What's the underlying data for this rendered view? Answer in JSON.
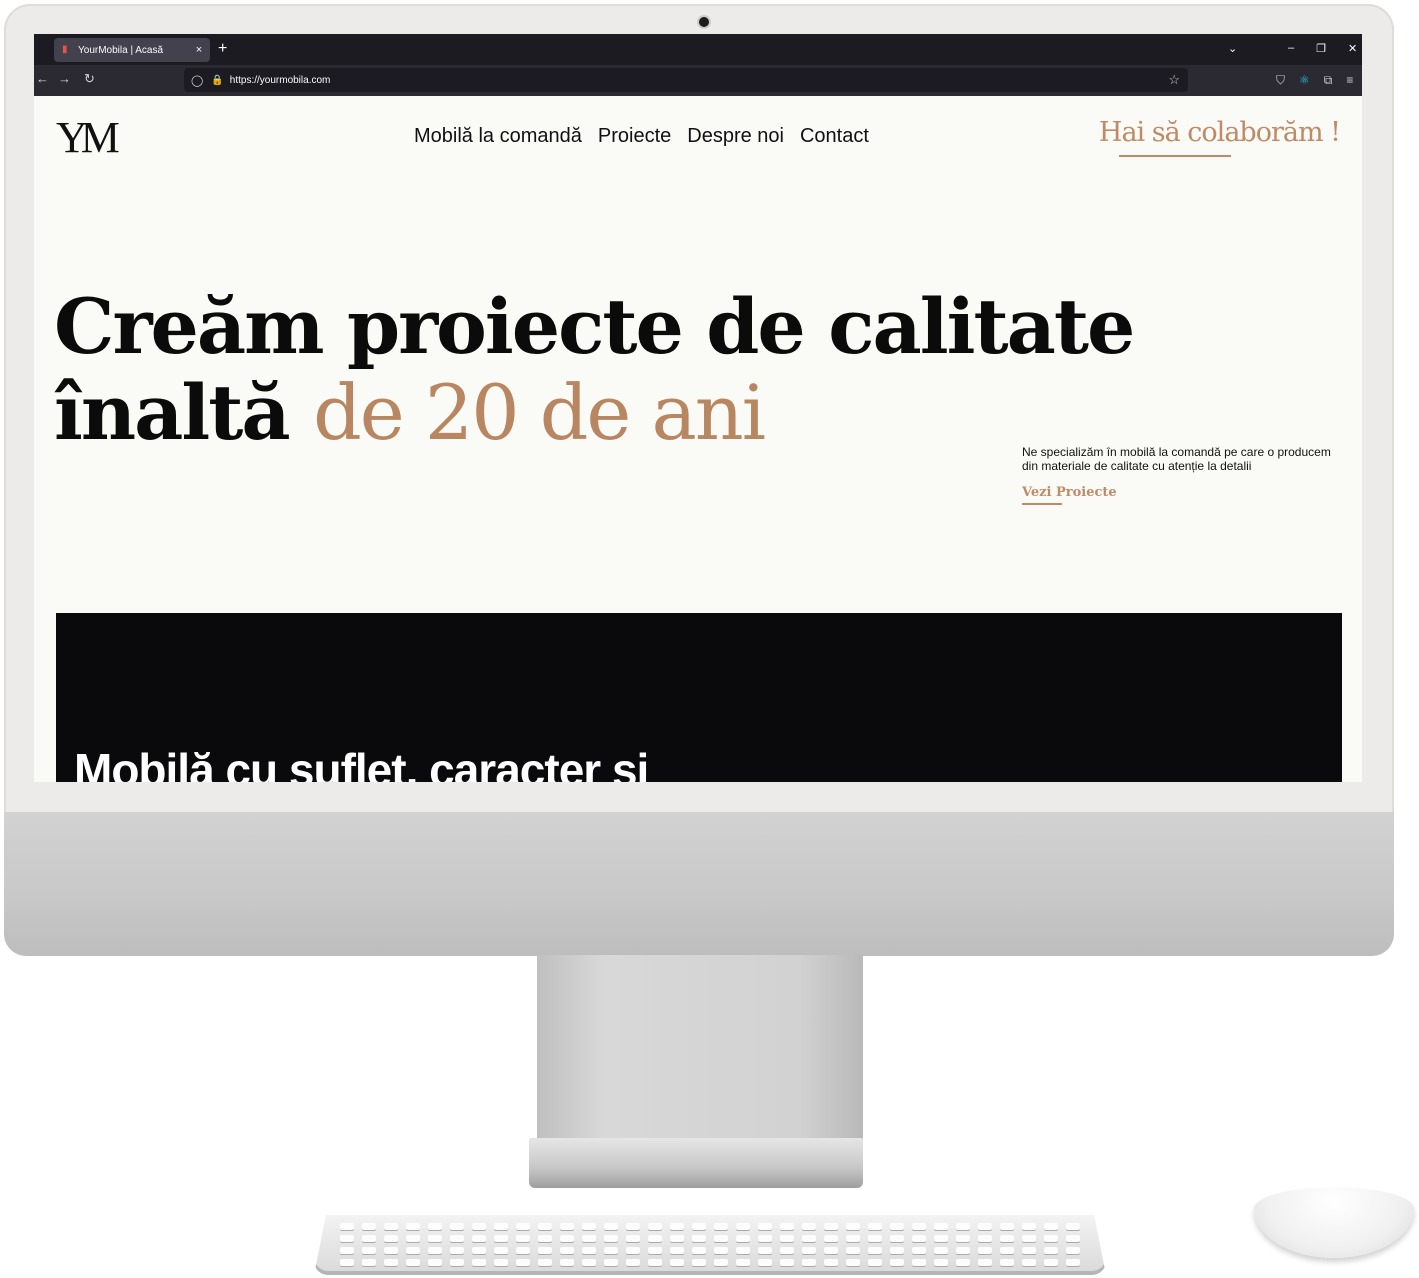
{
  "browser": {
    "tab_title": "YourMobila | Acasă",
    "tab_close": "×",
    "new_tab": "+",
    "tab_list": "⌄",
    "window_controls": [
      "–",
      "❐",
      "✕"
    ],
    "url": "https://yourmobila.com",
    "nav_icons": {
      "back": "←",
      "forward": "→",
      "reload": "↻"
    },
    "toolbar_icons": [
      "pocket-icon",
      "react-devtools-icon",
      "extensions-icon",
      "menu-icon"
    ],
    "toolbar_glyphs": [
      "⛉",
      "⚛",
      "⧉",
      "≡"
    ]
  },
  "site": {
    "logo": "YM",
    "nav": [
      "Mobilă la comandă",
      "Proiecte",
      "Despre noi",
      "Contact"
    ],
    "cta": "Hai să colaborăm !",
    "hero": {
      "title_line1": "Creăm proiecte de calitate",
      "title_line2_start": "înaltă",
      "title_line2_accent": "de 20 de ani",
      "description": "Ne specializăm în mobilă la comandă pe care o producem din materiale de calitate cu atenție la detalii",
      "link": "Vezi Proiecte"
    },
    "dark_section_heading": "Mobilă cu suflet, caracter și"
  },
  "colors": {
    "accent": "#bf8a66",
    "page_background": "#fafbf6",
    "dark_section": "#0a0a0c",
    "browser_chrome": "#1c1b22"
  }
}
